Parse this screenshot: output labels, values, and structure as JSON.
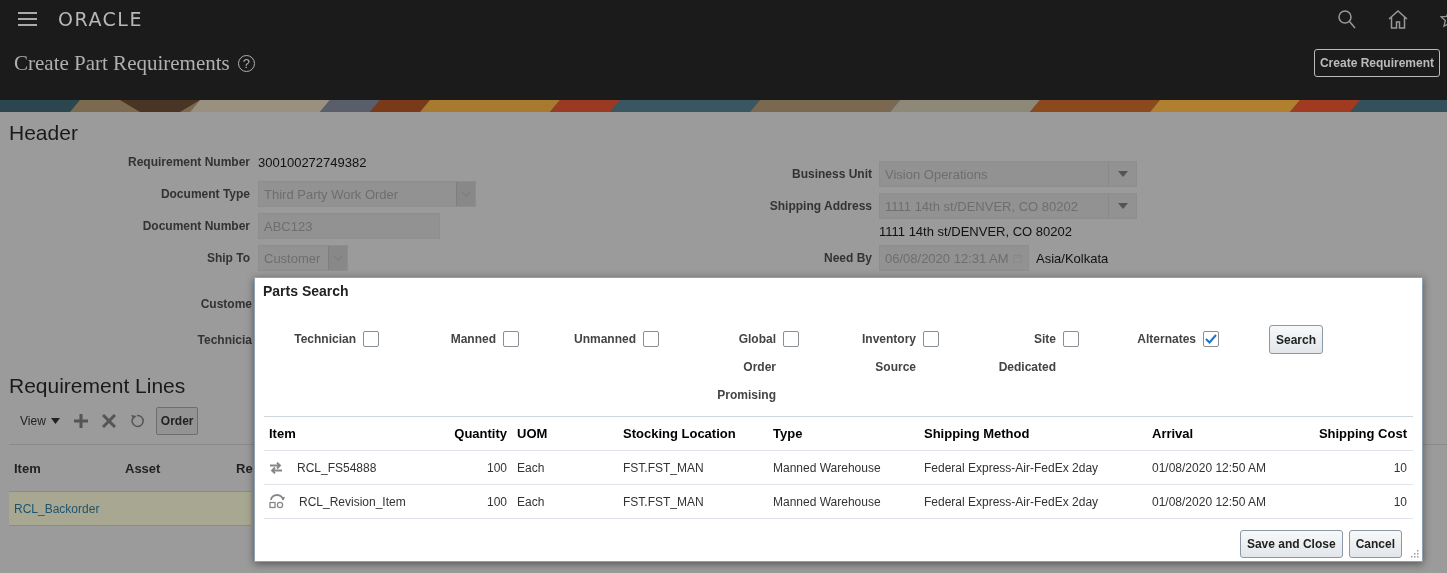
{
  "top_bar": {
    "logo": "ORACLE"
  },
  "page": {
    "title": "Create Part Requirements",
    "help": "?",
    "action_button": "Create Requirement"
  },
  "header": {
    "title": "Header",
    "left_fields": [
      {
        "label": "Requirement Number",
        "kind": "text",
        "value": "300100272749382"
      },
      {
        "label": "Document Type",
        "kind": "select",
        "value": "Third Party Work Order",
        "disabled": true
      },
      {
        "label": "Document Number",
        "kind": "input",
        "value": "ABC123",
        "disabled": true
      },
      {
        "label": "Ship To",
        "kind": "select",
        "value": "Customer",
        "disabled": true
      },
      {
        "label": "Custome",
        "kind": "covered"
      },
      {
        "label": "Technicia",
        "kind": "covered"
      }
    ],
    "right_fields": [
      {
        "label": "Business Unit",
        "kind": "dropdown",
        "value": "Vision Operations",
        "disabled": true
      },
      {
        "label": "Shipping Address",
        "kind": "dropdown",
        "value": "1111 14th st/DENVER, CO 80202",
        "disabled": true
      },
      {
        "kind": "text",
        "value": "1111 14th st/DENVER, CO 80202"
      },
      {
        "label": "Need By",
        "kind": "date",
        "value": "06/08/2020 12:31 AM",
        "timezone": "Asia/Kolkata",
        "disabled": true
      }
    ]
  },
  "requirement_lines": {
    "title": "Requirement Lines",
    "view_menu": "View",
    "order_button": "Order",
    "columns": [
      "Item",
      "Asset",
      "Re"
    ],
    "rows": [
      {
        "cells": [
          "RCL_Backorder"
        ],
        "selected": true
      }
    ]
  },
  "dialog": {
    "title": "Parts Search",
    "filters": [
      {
        "label": "Technician",
        "checked": false
      },
      {
        "label": "Manned",
        "checked": false
      },
      {
        "label": "Unmanned",
        "checked": false
      },
      {
        "label": "Global Order Promising",
        "checked": false
      },
      {
        "label": "Inventory Source",
        "checked": false
      },
      {
        "label": "Site Dedicated",
        "checked": false
      },
      {
        "label": "Alternates",
        "checked": true
      }
    ],
    "search_button": "Search",
    "table": {
      "columns": [
        "Item",
        "Quantity",
        "UOM",
        "Stocking Location",
        "Type",
        "Shipping Method",
        "Arrival",
        "Shipping Cost"
      ],
      "rows": [
        {
          "kind": "alternate",
          "cells": [
            "RCL_FS54888",
            "100",
            "Each",
            "FST.FST_MAN",
            "Manned Warehouse",
            "Federal Express-Air-FedEx 2day",
            "01/08/2020 12:50 AM",
            "10"
          ]
        },
        {
          "kind": "revision",
          "cells": [
            "RCL_Revision_Item",
            "100",
            "Each",
            "FST.FST_MAN",
            "Manned Warehouse",
            "Federal Express-Air-FedEx 2day",
            "01/08/2020 12:50 AM",
            "10"
          ]
        }
      ]
    },
    "buttons": [
      "Save and Close",
      "Cancel"
    ]
  }
}
